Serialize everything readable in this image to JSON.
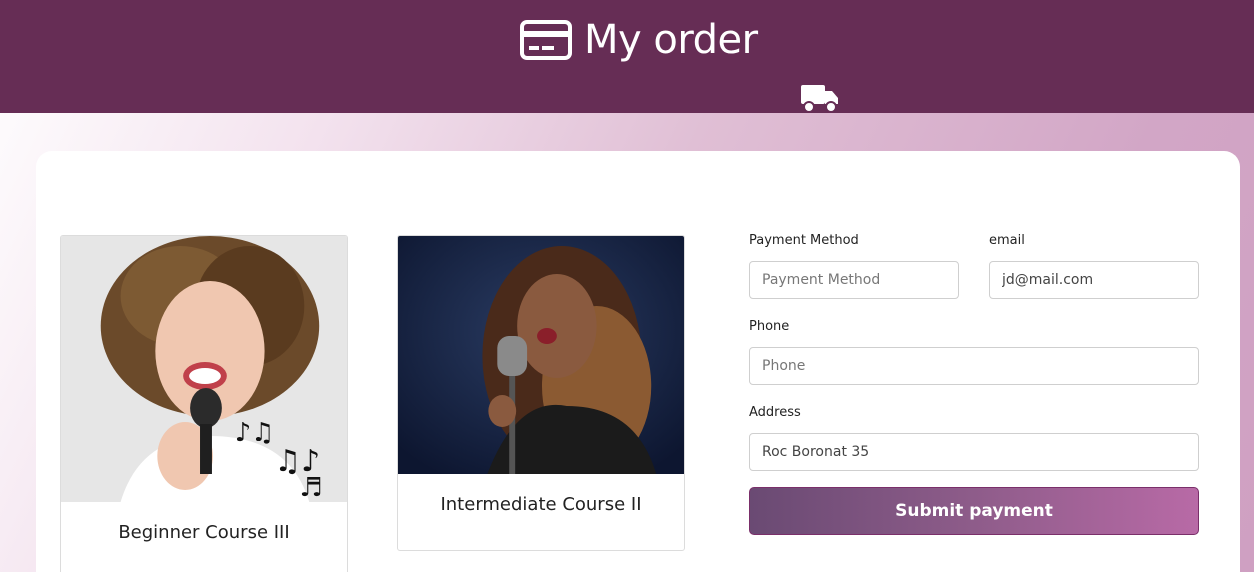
{
  "header": {
    "title": "My order",
    "title_icon": "credit-card-icon",
    "shipping_icon": "truck-icon",
    "bg_color": "#662d55"
  },
  "courses": [
    {
      "name": "Beginner Course III",
      "image": "woman-singing-with-microphone-photo"
    },
    {
      "name": "Intermediate Course II",
      "image": "woman-singing-vintage-microphone-photo"
    }
  ],
  "form": {
    "payment_method": {
      "label": "Payment Method",
      "placeholder": "Payment Method",
      "value": ""
    },
    "email": {
      "label": "email",
      "placeholder": "",
      "value": "jd@mail.com"
    },
    "phone": {
      "label": "Phone",
      "placeholder": "Phone",
      "value": ""
    },
    "address": {
      "label": "Address",
      "placeholder": "",
      "value": "Roc Boronat 35"
    },
    "submit_label": "Submit payment"
  },
  "colors": {
    "accent": "#662d55",
    "button_start": "#6a4a73",
    "button_end": "#b86aa6"
  }
}
